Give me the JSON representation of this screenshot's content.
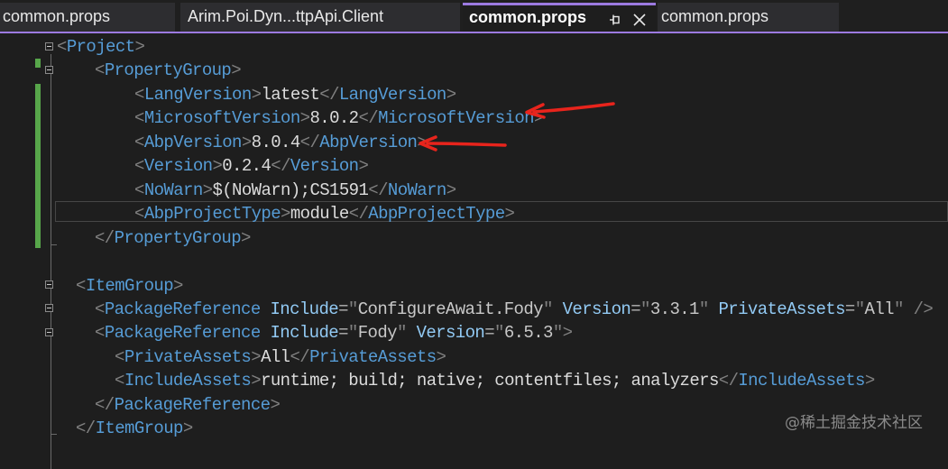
{
  "tabs": [
    {
      "label": "common.props"
    },
    {
      "label": "Arim.Poi.Dyn...ttpApi.Client"
    },
    {
      "label": "common.props",
      "active": true
    },
    {
      "label": "common.props"
    }
  ],
  "active_tab": {
    "pin_icon": "pin-icon",
    "close_icon": "close-icon"
  },
  "colors": {
    "accent": "#9c7ae0",
    "tag": "#569cd6",
    "attribute": "#92caf4",
    "bracket": "#808080",
    "text": "#dcdcdc",
    "change_marker": "#57a64a",
    "annotation_arrow": "#e8241c"
  },
  "code": {
    "project_open": "Project",
    "property_group_open": "PropertyGroup",
    "lang_version_tag": "LangVersion",
    "lang_version_value": "latest",
    "microsoft_version_tag": "MicrosoftVersion",
    "microsoft_version_value": "8.0.2",
    "abp_version_tag": "AbpVersion",
    "abp_version_value": "8.0.4",
    "version_tag": "Version",
    "version_value": "0.2.4",
    "nowarn_tag": "NoWarn",
    "nowarn_value": "$(NoWarn);CS1591",
    "abp_project_type_tag": "AbpProjectType",
    "abp_project_type_value": "module",
    "property_group_close": "PropertyGroup",
    "item_group_open": "ItemGroup",
    "package_reference_tag": "PackageReference",
    "include_attr": "Include",
    "version_attr": "Version",
    "private_assets_attr": "PrivateAssets",
    "pkg1_include": "ConfigureAwait.Fody",
    "pkg1_version": "3.3.1",
    "pkg1_private_assets": "All",
    "pkg2_include": "Fody",
    "pkg2_version": "6.5.3",
    "private_assets_tag": "PrivateAssets",
    "private_assets_value": "All",
    "include_assets_tag": "IncludeAssets",
    "include_assets_value": "runtime; build; native; contentfiles; analyzers",
    "package_reference_close": "PackageReference",
    "item_group_close": "ItemGroup"
  },
  "watermark": "@稀土掘金技术社区"
}
